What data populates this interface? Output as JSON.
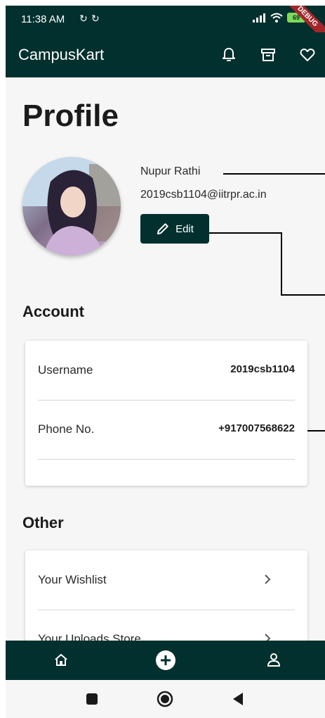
{
  "status_bar": {
    "time": "11:38 AM",
    "battery": "69",
    "debug_banner": "DEBUG",
    "icons": [
      "sync-icon",
      "sync-icon",
      "signal-icon",
      "wifi-icon",
      "battery-icon"
    ]
  },
  "app_bar": {
    "title": "CampusKart",
    "actions": [
      "bell-icon",
      "archive-icon",
      "heart-icon"
    ]
  },
  "page": {
    "title": "Profile"
  },
  "profile": {
    "name": "Nupur Rathi",
    "email": "2019csb1104@iitrpr.ac.in",
    "edit_label": "Edit"
  },
  "account": {
    "title": "Account",
    "rows": [
      {
        "label": "Username",
        "value": "2019csb1104"
      },
      {
        "label": "Phone No.",
        "value": "+917007568622"
      }
    ]
  },
  "other": {
    "title": "Other",
    "rows": [
      {
        "label": "Your Wishlist"
      },
      {
        "label": "Your Uploads Store"
      }
    ]
  },
  "bottom_nav": [
    "home-icon",
    "add-circle-icon",
    "person-icon"
  ],
  "system_nav": [
    "recents-icon",
    "home-circle-icon",
    "back-icon"
  ],
  "colors": {
    "primary": "#01302e",
    "background": "#f6f6f6",
    "debug": "#a3262a",
    "battery": "#7ed957"
  }
}
